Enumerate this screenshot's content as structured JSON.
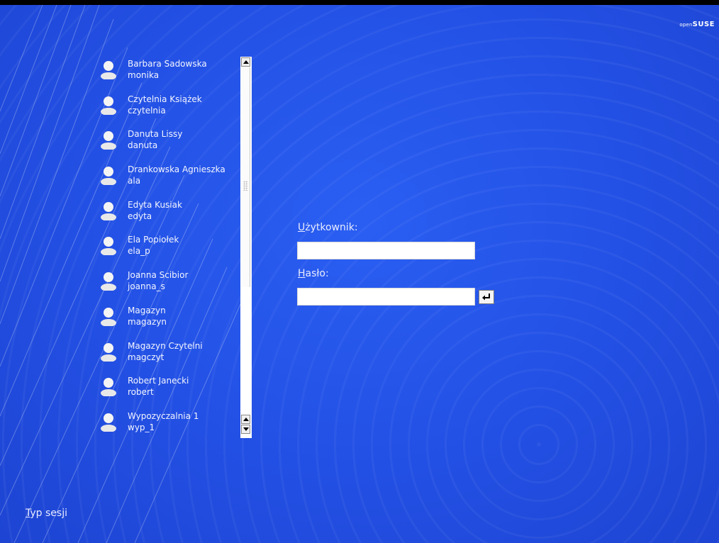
{
  "brand": {
    "prefix": "open",
    "name": "SUSE"
  },
  "users": [
    {
      "name": "Barbara Sadowska",
      "login": "monika"
    },
    {
      "name": "Czytelnia Książek",
      "login": "czytelnia"
    },
    {
      "name": "Danuta Lissy",
      "login": "danuta"
    },
    {
      "name": "Drankowska Agnieszka",
      "login": "ala"
    },
    {
      "name": "Edyta Kusiak",
      "login": "edyta"
    },
    {
      "name": "Ela Popiołek",
      "login": "ela_p"
    },
    {
      "name": "Joanna Scibior",
      "login": "joanna_s"
    },
    {
      "name": "Magazyn",
      "login": "magazyn"
    },
    {
      "name": "Magazyn Czytelni",
      "login": "magczyt"
    },
    {
      "name": "Robert Janecki",
      "login": "robert"
    },
    {
      "name": "Wypozyczalnia 1",
      "login": "wyp_1"
    }
  ],
  "login_form": {
    "username_label_accel": "U",
    "username_label_rest": "żytkownik:",
    "username_value": "",
    "password_label_accel": "H",
    "password_label_rest": "asło:",
    "password_value": ""
  },
  "session": {
    "accel": "T",
    "rest": "yp sesji"
  },
  "colors": {
    "background": "#2350e4",
    "text": "#f2f5ff"
  }
}
